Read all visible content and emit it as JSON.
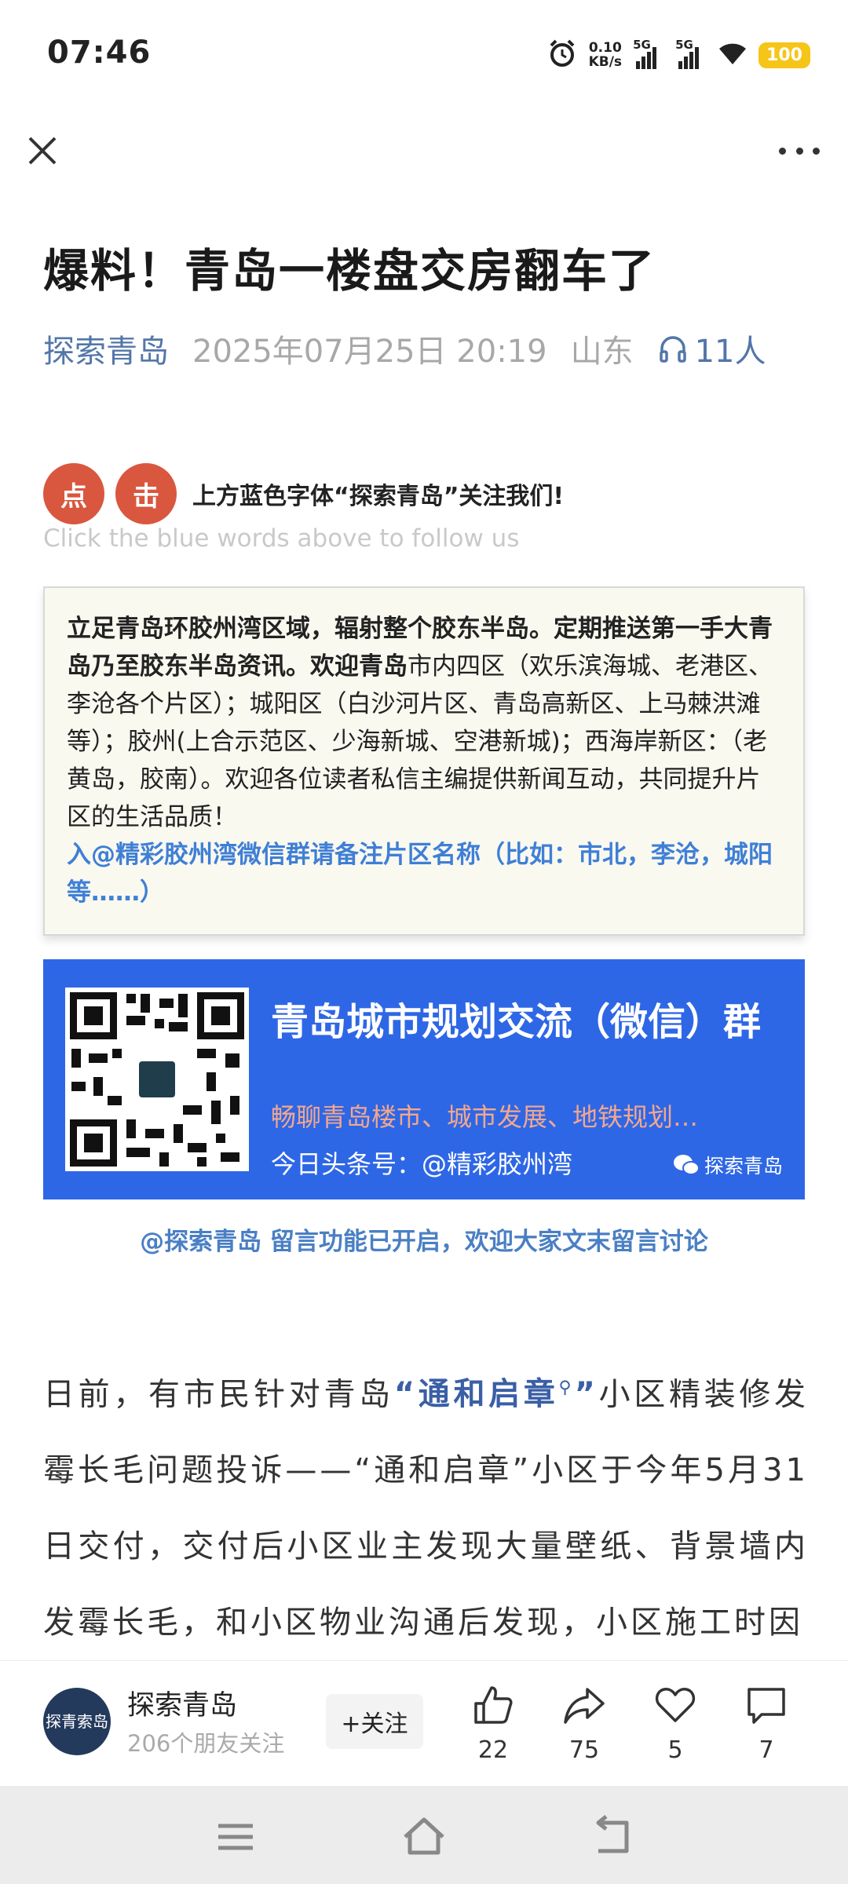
{
  "status_bar": {
    "time": "07:46",
    "net_speed_value": "0.10",
    "net_speed_unit": "KB/s",
    "signal1_label": "5G",
    "signal2_label": "5G",
    "battery": "100",
    "battery_color": "#f5c518"
  },
  "nav": {
    "close_icon": "close-icon",
    "more_icon": "more-icon"
  },
  "article": {
    "title": "爆料！青岛一楼盘交房翻车了",
    "author": "探索青岛",
    "datetime": "2025年07月25日 20:19",
    "location": "山东",
    "listeners": "11人",
    "follow_circle_1": "点",
    "follow_circle_2": "击",
    "follow_prompt": "上方蓝色字体“探索青岛”关注我们!",
    "follow_prompt_en": "Click the blue words above to follow us",
    "intro_bold": "立足青岛环胶州湾区域，辐射整个胶东半岛。定期推送第一手大青岛乃至胶东半岛资讯。欢迎青岛",
    "intro_normal": "市内四区（欢乐滨海城、老港区、李沧各个片区）；城阳区（白沙河片区、青岛高新区、上马棘洪滩等）；胶州(上合示范区、少海新城、空港新城)；西海岸新区：（老黄岛，胶南）。欢迎各位读者私信主编提供新闻互动，共同提升片区的生活品质！",
    "intro_blue": "入@精彩胶州湾微信群请备注片区名称（比如：市北，李沧，城阳等……）",
    "banner_title": "青岛城市规划交流（微信）群",
    "banner_subtitle": "畅聊青岛楼市、城市发展、地铁规划…",
    "banner_handle": "今日头条号：@精彩胶州湾",
    "banner_brand": "探索青岛",
    "comment_notice": "@探索青岛 留言功能已开启，欢迎大家文末留言讨论",
    "body_p1_a": "日前，有市民针对青岛",
    "body_kw": "“通和启章",
    "body_kw_end": "”",
    "body_p1_b": "小区精装修发霉长毛问题投诉——“通和启章”小区于今年5月31日交付，交付后小区业主发现大量壁纸、背景墙内发霉长毛，和小区物业沟通后发现，小区施工时因"
  },
  "bottom_bar": {
    "avatar_text": "探青索岛",
    "account_name": "探索青岛",
    "followers": "206个朋友关注",
    "follow_button": "+关注",
    "likes": "22",
    "shares": "75",
    "favorites": "5",
    "comments": "7"
  },
  "colors": {
    "accent_blue": "#5276a8",
    "banner_blue": "#2e67e6",
    "circle_red": "#d9573f"
  }
}
